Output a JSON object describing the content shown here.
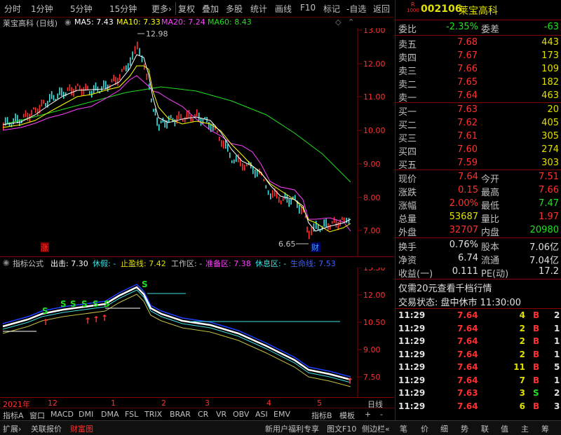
{
  "toolbar": {
    "items": [
      "分时",
      "1分钟",
      "5分钟",
      "15分钟",
      "更多›"
    ],
    "right_items": [
      "复权",
      "叠加",
      "多股",
      "统计",
      "画线",
      "F10",
      "标记",
      "-自选",
      "返回"
    ]
  },
  "main_chart": {
    "title": "莱宝高科 (日线)",
    "ma5": "MA5: 7.43",
    "ma10": "MA10: 7.33",
    "ma20": "MA20: 7.24",
    "ma60": "MA60: 8.43",
    "high_label": "12.98",
    "low_label": "6.65",
    "zhang_label": "涨",
    "cai_label": "财",
    "y_ticks": [
      "13.00",
      "12.00",
      "11.00",
      "10.00",
      "9.00",
      "8.00",
      "7.00"
    ],
    "colors": {
      "ma5": "#ffffff",
      "ma10": "#ffff00",
      "ma20": "#ff40ff",
      "ma60": "#20e020"
    }
  },
  "indicator_chart": {
    "name": "指标公式",
    "chuji": "出击: 7.30",
    "xiujia": "休假: -",
    "zhiying": "止盈线: 7.42",
    "gongzuo": "工作区: -",
    "zhunbei": "准备区: 7.38",
    "xiuxi": "休息区: -",
    "shengming": "生命线: 7.53",
    "y_ticks": [
      "13.50",
      "12.00",
      "10.50",
      "9.00",
      "7.50"
    ]
  },
  "x_axis": {
    "labels": [
      "2021年",
      "12",
      "1",
      "2",
      "3",
      "4",
      "5"
    ],
    "period": "日线"
  },
  "bottom_tabs": [
    "指标A",
    "窗口",
    "MACD",
    "DMI",
    "DMA",
    "FSL",
    "TRIX",
    "BRAR",
    "CR",
    "VR",
    "OBV",
    "ASI",
    "EMV",
    "指标B",
    "模板",
    "+",
    "-"
  ],
  "status_bar": {
    "left": [
      "扩展›",
      "关联报价",
      "财富图"
    ],
    "right": [
      "新用户福利专享",
      "图文F10",
      "侧边栏«"
    ],
    "icons": [
      "笔",
      "价",
      "细",
      "势",
      "联",
      "值",
      "主",
      "筹"
    ]
  },
  "quote": {
    "code": "002106",
    "name": "莱宝高科",
    "badge_top": "R",
    "badge_bottom": "1000",
    "weibi_label": "委比",
    "weibi_value": "-2.35%",
    "weicha_label": "委差",
    "weicha_value": "-63",
    "sell": [
      {
        "label": "卖五",
        "price": "7.68",
        "vol": "443"
      },
      {
        "label": "卖四",
        "price": "7.67",
        "vol": "173"
      },
      {
        "label": "卖三",
        "price": "7.66",
        "vol": "109"
      },
      {
        "label": "卖二",
        "price": "7.65",
        "vol": "182"
      },
      {
        "label": "卖一",
        "price": "7.64",
        "vol": "463"
      }
    ],
    "buy": [
      {
        "label": "买一",
        "price": "7.63",
        "vol": "20"
      },
      {
        "label": "买二",
        "price": "7.62",
        "vol": "405"
      },
      {
        "label": "买三",
        "price": "7.61",
        "vol": "305"
      },
      {
        "label": "买四",
        "price": "7.60",
        "vol": "274"
      },
      {
        "label": "买五",
        "price": "7.59",
        "vol": "303"
      }
    ],
    "stats": [
      {
        "l1": "现价",
        "v1": "7.64",
        "c1": "red",
        "l2": "今开",
        "v2": "7.51",
        "c2": "red"
      },
      {
        "l1": "涨跌",
        "v1": "0.15",
        "c1": "red",
        "l2": "最高",
        "v2": "7.66",
        "c2": "red"
      },
      {
        "l1": "涨幅",
        "v1": "2.00%",
        "c1": "red",
        "l2": "最低",
        "v2": "7.47",
        "c2": "green"
      },
      {
        "l1": "总量",
        "v1": "53687",
        "c1": "yellow",
        "l2": "量比",
        "v2": "1.97",
        "c2": "red"
      },
      {
        "l1": "外盘",
        "v1": "32707",
        "c1": "red",
        "l2": "内盘",
        "v2": "20980",
        "c2": "green"
      }
    ],
    "stats2": [
      {
        "l1": "换手",
        "v1": "0.76%",
        "l2": "股本",
        "v2": "7.06亿"
      },
      {
        "l1": "净资",
        "v1": "6.74",
        "l2": "流通",
        "v2": "7.04亿"
      },
      {
        "l1": "收益(一)",
        "v1": "0.111",
        "l2": "PE(动)",
        "v2": "17.2"
      }
    ],
    "promo": "仅需20元查看千档行情",
    "trade_status_label": "交易状态:",
    "trade_status_value": "盘中休市 11:30:00",
    "ticks": [
      {
        "time": "11:29",
        "price": "7.64",
        "vol": "4",
        "side": "B",
        "n": "2"
      },
      {
        "time": "11:29",
        "price": "7.64",
        "vol": "2",
        "side": "B",
        "n": "1"
      },
      {
        "time": "11:29",
        "price": "7.64",
        "vol": "2",
        "side": "B",
        "n": "1"
      },
      {
        "time": "11:29",
        "price": "7.64",
        "vol": "2",
        "side": "B",
        "n": "1"
      },
      {
        "time": "11:29",
        "price": "7.64",
        "vol": "11",
        "side": "B",
        "n": "5"
      },
      {
        "time": "11:29",
        "price": "7.64",
        "vol": "7",
        "side": "B",
        "n": "1"
      },
      {
        "time": "11:29",
        "price": "7.63",
        "vol": "3",
        "side": "S",
        "n": "2"
      },
      {
        "time": "11:29",
        "price": "7.64",
        "vol": "6",
        "side": "B",
        "n": "3"
      }
    ]
  }
}
